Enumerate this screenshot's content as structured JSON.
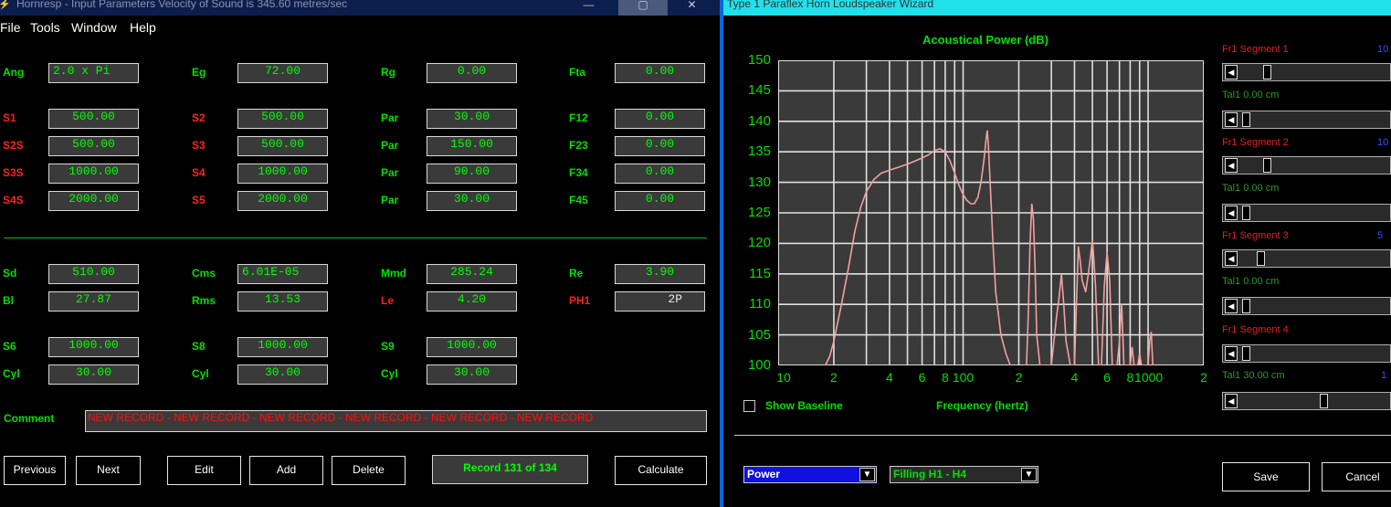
{
  "left_window": {
    "title": "Hornresp - Input Parameters   Velocity of Sound is 345.60 metres/sec",
    "title_buttons": [
      "—",
      "▢",
      "✕"
    ],
    "menu": [
      "File",
      "Tools",
      "Window",
      "Help"
    ],
    "params": [
      {
        "label": "Ang",
        "value": "2.0 x Pi",
        "red": false
      },
      {
        "label": "Eg",
        "value": "72.00",
        "red": false
      },
      {
        "label": "Rg",
        "value": "0.00",
        "red": false
      },
      {
        "label": "Fta",
        "value": "0.00",
        "red": false
      },
      {
        "label": "S1",
        "value": "500.00",
        "red": true
      },
      {
        "label": "S2",
        "value": "500.00",
        "red": true
      },
      {
        "label": "Par",
        "value": "30.00",
        "red": false
      },
      {
        "label": "F12",
        "value": "0.00",
        "red": false
      },
      {
        "label": "S2S",
        "value": "500.00",
        "red": true
      },
      {
        "label": "S3",
        "value": "500.00",
        "red": true
      },
      {
        "label": "Par",
        "value": "150.00",
        "red": false
      },
      {
        "label": "F23",
        "value": "0.00",
        "red": false
      },
      {
        "label": "S3S",
        "value": "1000.00",
        "red": true
      },
      {
        "label": "S4",
        "value": "1000.00",
        "red": true
      },
      {
        "label": "Par",
        "value": "90.00",
        "red": false
      },
      {
        "label": "F34",
        "value": "0.00",
        "red": false
      },
      {
        "label": "S4S",
        "value": "2000.00",
        "red": true
      },
      {
        "label": "S5",
        "value": "2000.00",
        "red": true
      },
      {
        "label": "Par",
        "value": "30.00",
        "red": false
      },
      {
        "label": "F45",
        "value": "0.00",
        "red": false
      },
      {
        "label": "Sd",
        "value": "510.00",
        "red": false
      },
      {
        "label": "Cms",
        "value": "6.01E-05",
        "red": false
      },
      {
        "label": "Mmd",
        "value": "285.24",
        "red": false
      },
      {
        "label": "Re",
        "value": "3.90",
        "red": false
      },
      {
        "label": "Bl",
        "value": "27.87",
        "red": false
      },
      {
        "label": "Rms",
        "value": "13.53",
        "red": false
      },
      {
        "label": "Le",
        "value": "4.20",
        "red": true
      },
      {
        "label": "PH1",
        "value": "2P",
        "red": true
      },
      {
        "label": "S6",
        "value": "1000.00",
        "red": false
      },
      {
        "label": "S8",
        "value": "1000.00",
        "red": false
      },
      {
        "label": "S9",
        "value": "1000.00",
        "red": false
      },
      {
        "label": "Cyl",
        "value": "30.00",
        "red": false
      },
      {
        "label": "Cyl",
        "value": "30.00",
        "red": false
      },
      {
        "label": "Cyl",
        "value": "30.00",
        "red": false
      }
    ],
    "comment_label": "Comment",
    "comment_value": "NEW RECORD - NEW RECORD - NEW RECORD - NEW RECORD - NEW RECORD - NEW RECORD",
    "buttons": {
      "previous": "Previous",
      "next": "Next",
      "edit": "Edit",
      "add": "Add",
      "delete": "Delete",
      "calculate": "Calculate"
    },
    "record_status": "Record 131 of 134"
  },
  "right_window": {
    "title": "Type 1 Paraflex Horn Loudspeaker Wizard",
    "show_baseline_label": "Show Baseline",
    "show_baseline_checked": false,
    "combo_power": "Power",
    "combo_filling": "Filling H1 - H4",
    "save_label": "Save",
    "cancel_label": "Cancel",
    "segments": [
      {
        "fr_label": "Fr1  Segment 1",
        "right_value": "10",
        "tal_label": "Tal1  0.00 cm",
        "right2": ""
      },
      {
        "fr_label": "Fr1  Segment 2",
        "right_value": "10",
        "tal_label": "Tal1  0.00 cm",
        "right2": ""
      },
      {
        "fr_label": "Fr1  Segment 3",
        "right_value": "5",
        "tal_label": "Tal1  0.00 cm",
        "right2": ""
      },
      {
        "fr_label": "Fr1  Segment 4",
        "right_value": "",
        "tal_label": "Tal1  30.00 cm",
        "right2": "1"
      }
    ],
    "slider_positions": [
      0.16,
      0.02,
      0.16,
      0.02,
      0.12,
      0.02,
      0.02,
      0.55
    ]
  },
  "colors": {
    "label_green": "#00e000",
    "label_red": "#ff2020",
    "accent_blue": "#0a66d6",
    "title_cyan": "#20e0ea",
    "curve": "#f2a0a0"
  },
  "chart_data": {
    "type": "line",
    "title": "Acoustical Power (dB)",
    "xlabel": "Frequency (hertz)",
    "ylabel": "",
    "x_scale": "log",
    "xlim": [
      10,
      2000
    ],
    "ylim": [
      100,
      150
    ],
    "yticks": [
      100,
      105,
      110,
      115,
      120,
      125,
      130,
      135,
      140,
      145,
      150
    ],
    "xtick_labels": [
      "10",
      "2",
      "4",
      "6",
      "8",
      "100",
      "2",
      "4",
      "6",
      "8",
      "1000",
      "2"
    ],
    "grid": true,
    "series": [
      {
        "x": [
          18,
          19,
          20,
          22,
          24,
          26,
          28,
          30,
          33,
          36,
          40,
          45,
          50,
          55,
          60,
          65,
          70,
          75,
          80,
          85,
          90,
          95,
          100,
          105,
          110,
          115,
          120,
          125,
          130,
          133,
          135,
          137,
          140,
          145,
          150,
          160,
          170,
          180
        ],
        "y": [
          100,
          101.5,
          104,
          110,
          116,
          122,
          126,
          128.5,
          130.5,
          131.5,
          132,
          132.5,
          133,
          133.5,
          134,
          134.5,
          135.2,
          135.5,
          135,
          133.5,
          131.5,
          129.5,
          128,
          127,
          126.5,
          126.5,
          127.5,
          130,
          134,
          137,
          138.5,
          136,
          130,
          120,
          112,
          105,
          102,
          100
        ]
      },
      {
        "x": [
          220,
          225,
          230,
          235,
          240,
          245,
          250,
          260,
          280,
          300,
          320,
          330,
          340,
          350,
          360,
          380,
          400,
          410,
          420,
          430,
          440,
          460,
          480,
          500,
          510,
          520,
          540,
          560,
          580,
          600,
          620,
          640,
          680,
          700,
          720,
          740,
          800,
          820,
          840,
          860,
          880,
          900,
          920,
          940,
          960,
          980,
          1000,
          1020,
          1040,
          1060
        ],
        "y": [
          100,
          108,
          120,
          126.5,
          124,
          116,
          105,
          100,
          100,
          100,
          108,
          111,
          115,
          110,
          104,
          100,
          100,
          110,
          119.5,
          117,
          114,
          112,
          116,
          120.5,
          117,
          113,
          100,
          100,
          113,
          118.5,
          114,
          100,
          100,
          104,
          110,
          100,
          100,
          103,
          100,
          100,
          100,
          102,
          100,
          100,
          100,
          100,
          100,
          104,
          105.5,
          100
        ]
      }
    ]
  }
}
